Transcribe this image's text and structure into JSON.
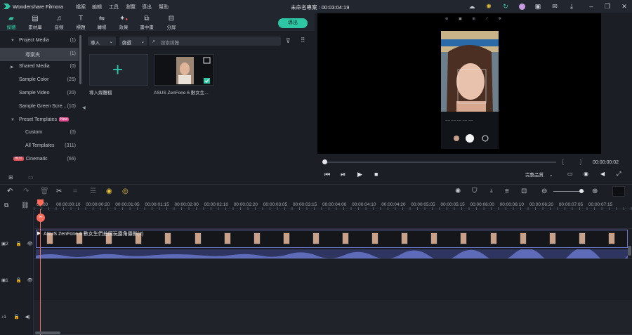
{
  "title_bar": {
    "app_name": "Wondershare Filmora",
    "menus": [
      "檔案",
      "編輯",
      "工具",
      "瀏覽",
      "導出",
      "幫助"
    ],
    "project": "未命名專案 : 00:03:04:19"
  },
  "toolbar": {
    "tools": [
      {
        "label": "媒體",
        "icon": "folder-icon"
      },
      {
        "label": "素材庫",
        "icon": "stock-icon"
      },
      {
        "label": "音頻",
        "icon": "music-icon"
      },
      {
        "label": "標題",
        "icon": "text-icon"
      },
      {
        "label": "轉場",
        "icon": "transition-icon"
      },
      {
        "label": "效果",
        "icon": "effects-icon"
      },
      {
        "label": "畫中畫",
        "icon": "pip-icon"
      },
      {
        "label": "分屏",
        "icon": "splitscreen-icon"
      }
    ],
    "export_label": "導出"
  },
  "tree": [
    {
      "label": "Project Media",
      "count": "(1)",
      "arrow": "▼"
    },
    {
      "label": "導案夾",
      "count": "(1)",
      "selected": true
    },
    {
      "label": "Shared Media",
      "count": "(0)",
      "arrow": "▶"
    },
    {
      "label": "Sample Color",
      "count": "(25)"
    },
    {
      "label": "Sample Video",
      "count": "(20)"
    },
    {
      "label": "Sample Green Scre...",
      "count": "(10)"
    },
    {
      "label": "Preset Templates",
      "count": "",
      "arrow": "▼",
      "tag": "New"
    },
    {
      "label": "Custom",
      "count": "(0)"
    },
    {
      "label": "All Templates",
      "count": "(311)"
    },
    {
      "label": "Cinematic",
      "count": "(66)",
      "tag": "HOT"
    }
  ],
  "media": {
    "import_label": "導入",
    "sort_label": "篩選",
    "search_placeholder": "搜索媒體",
    "import_tile_label": "導入媒體檔",
    "video_tile_label": "ASUS ZenFone 6 數女生..."
  },
  "preview": {
    "time": "00:00:00:02",
    "quality": "完整品質"
  },
  "ruler": [
    "00:00",
    "00:00:00:10",
    "00:00:00:20",
    "00:00:01:05",
    "00:00:01:15",
    "00:00:02:00",
    "00:00:02:10",
    "00:00:02:20",
    "00:00:03:05",
    "00:00:03:15",
    "00:00:04:00",
    "00:00:04:10",
    "00:00:04:20",
    "00:00:05:05",
    "00:00:05:15",
    "00:00:06:00",
    "00:00:06:10",
    "00:00:06:20",
    "00:00:07:05",
    "00:00:07:15"
  ],
  "tracks": [
    {
      "id": "2",
      "clip": "ASUS ZenFone 6 數女生們拍照玩露角攝影(2)"
    },
    {
      "id": "1",
      "clip": ""
    },
    {
      "id": "♪1",
      "clip": ""
    }
  ],
  "colors": {
    "accent": "#2ec7a5",
    "playhead": "#ff6b5a",
    "clip_border": "#6b74c9"
  }
}
